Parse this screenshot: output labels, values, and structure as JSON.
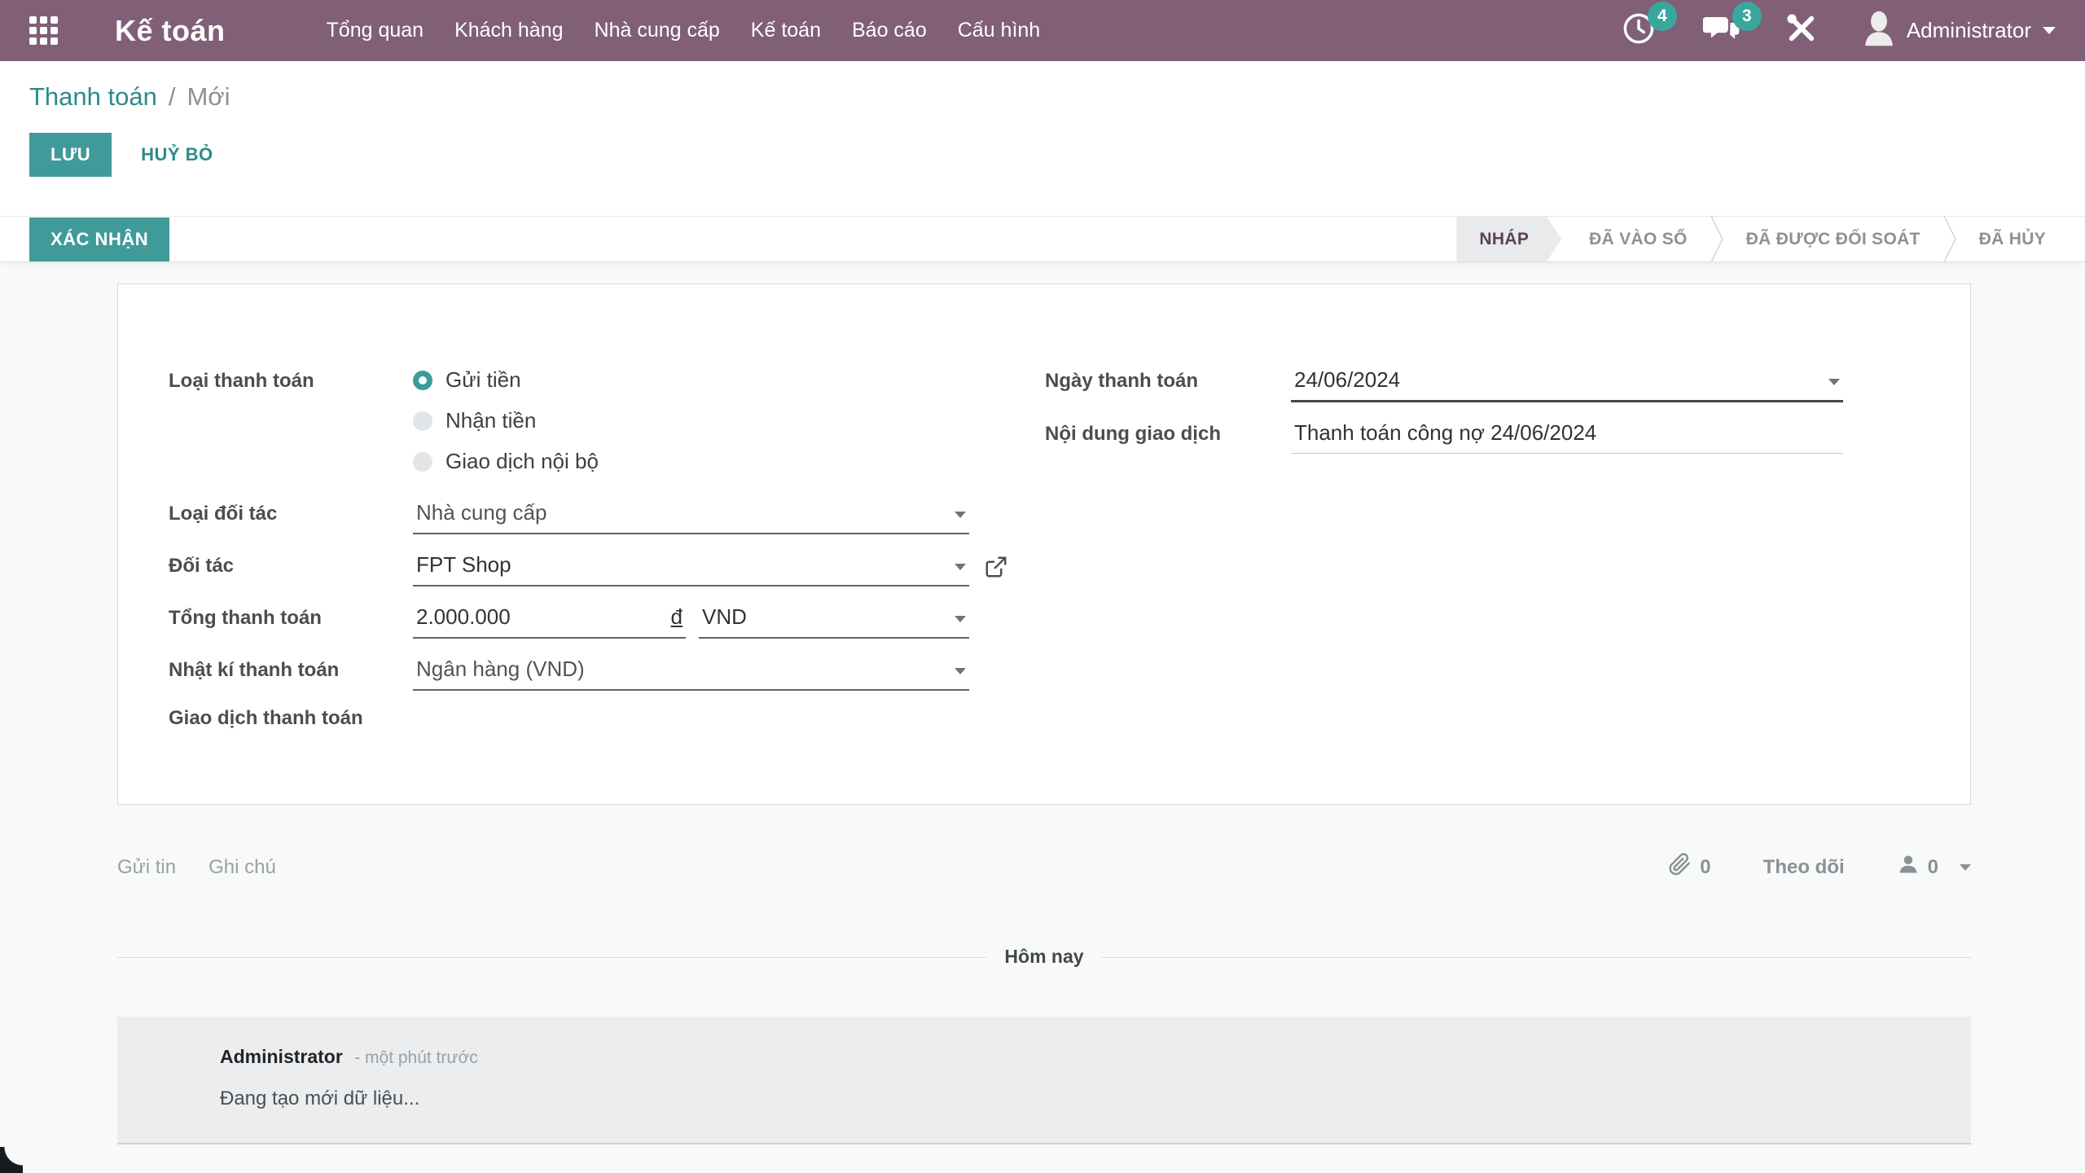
{
  "colors": {
    "navbar": "#805F77",
    "accent_teal": "#409A99",
    "badge_teal": "#3AA79E",
    "active_stage_text": "#5B4257"
  },
  "navbar": {
    "app_name": "Kế toán",
    "menus": [
      "Tổng quan",
      "Khách hàng",
      "Nhà cung cấp",
      "Kế toán",
      "Báo cáo",
      "Cấu hình"
    ],
    "activity_count": "4",
    "message_count": "3",
    "user": "Administrator"
  },
  "breadcrumb": {
    "parent": "Thanh toán",
    "separator": "/",
    "current": "Mới"
  },
  "actions": {
    "save": "LƯU",
    "discard": "HUỶ BỎ",
    "confirm": "XÁC NHẬN"
  },
  "statusbar": {
    "stages": [
      {
        "label": "NHÁP",
        "active": true
      },
      {
        "label": "ĐÃ VÀO SỔ",
        "active": false
      },
      {
        "label": "ĐÃ ĐƯỢC ĐỐI SOÁT",
        "active": false
      },
      {
        "label": "ĐÃ HỦY",
        "active": false
      }
    ]
  },
  "form": {
    "payment_type": {
      "label": "Loại thanh toán",
      "options": [
        {
          "label": "Gửi tiền",
          "selected": true
        },
        {
          "label": "Nhận tiền",
          "selected": false
        },
        {
          "label": "Giao dịch nội bộ",
          "selected": false
        }
      ]
    },
    "partner_type": {
      "label": "Loại đối tác",
      "value": "Nhà cung cấp"
    },
    "partner": {
      "label": "Đối tác",
      "value": "FPT Shop"
    },
    "amount": {
      "label": "Tổng thanh toán",
      "value": "2.000.000",
      "currency_symbol": "đ",
      "currency": "VND"
    },
    "journal": {
      "label": "Nhật kí thanh toán",
      "value": "Ngân hàng (VND)"
    },
    "transactions": {
      "label": "Giao dịch thanh toán"
    },
    "date": {
      "label": "Ngày thanh toán",
      "value": "24/06/2024"
    },
    "memo": {
      "label": "Nội dung giao dịch",
      "value": "Thanh toán công nợ 24/06/2024"
    }
  },
  "chatter": {
    "send_message": "Gửi tin",
    "log_note": "Ghi chú",
    "attachment_count": "0",
    "follow": "Theo dõi",
    "follower_count": "0",
    "date_separator": "Hôm nay",
    "message": {
      "author": "Administrator",
      "time": "- một phút trước",
      "body": "Đang tạo mới dữ liệu..."
    }
  }
}
